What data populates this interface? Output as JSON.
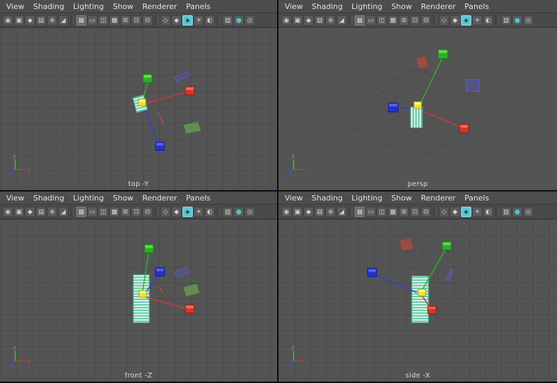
{
  "menu": {
    "items": [
      "View",
      "Shading",
      "Lighting",
      "Show",
      "Renderer",
      "Panels"
    ]
  },
  "panels": [
    {
      "id": "top",
      "label": "top -Y"
    },
    {
      "id": "persp",
      "label": "persp"
    },
    {
      "id": "front",
      "label": "front -Z"
    },
    {
      "id": "side",
      "label": "side -X"
    }
  ],
  "toolbar": {
    "icons": [
      {
        "name": "select-camera",
        "glyph": "◉"
      },
      {
        "name": "lock-camera",
        "glyph": "▣"
      },
      {
        "name": "camera-bookmark",
        "glyph": "◆"
      },
      {
        "name": "image-plane",
        "glyph": "▤"
      },
      {
        "name": "pan-zoom",
        "glyph": "⊕"
      },
      {
        "name": "grease-pencil",
        "glyph": "◢"
      },
      {
        "sep": true
      },
      {
        "name": "grid-toggle",
        "glyph": "▦",
        "pressed": true
      },
      {
        "name": "film-gate",
        "glyph": "▭"
      },
      {
        "name": "resolution-gate",
        "glyph": "◫"
      },
      {
        "name": "gate-mask",
        "glyph": "▩"
      },
      {
        "name": "field-chart",
        "glyph": "⊞"
      },
      {
        "name": "safe-action",
        "glyph": "⊡"
      },
      {
        "name": "safe-title",
        "glyph": "⊟"
      },
      {
        "sep": true
      },
      {
        "name": "wireframe-display",
        "glyph": "◇"
      },
      {
        "name": "smooth-shade-display",
        "glyph": "◆"
      },
      {
        "name": "textured-display",
        "glyph": "◈",
        "active": true
      },
      {
        "name": "lights-display",
        "glyph": "☀"
      },
      {
        "name": "shadows-display",
        "glyph": "◐"
      },
      {
        "sep": true
      },
      {
        "name": "xray-display",
        "glyph": "▥"
      },
      {
        "name": "default-material",
        "glyph": "●",
        "color": "#49c8d8"
      },
      {
        "name": "isolate-select",
        "glyph": "◎"
      }
    ]
  },
  "axis": {
    "x": "x",
    "y": "y",
    "z": "z"
  },
  "colors": {
    "toolbar_active": "#5fc6d4",
    "viewport_bg": "#545454",
    "grid_line": "#494a4b",
    "cube_green": "#2fae27",
    "cube_red": "#d5352c",
    "cube_blue": "#2430cf",
    "cube_yellow": "#ece62e",
    "plane_purple": "#5b55d6",
    "stripe_teal": "#66c9a8"
  }
}
